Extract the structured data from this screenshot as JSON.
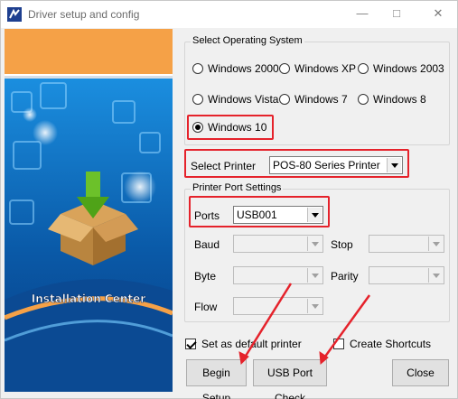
{
  "window": {
    "title": "Driver setup and config",
    "controls": [
      "minimize",
      "maximize",
      "close"
    ]
  },
  "banner": {
    "caption": "Installation Center"
  },
  "os_group": {
    "title": "Select Operating System",
    "options": [
      {
        "label": "Windows 2000",
        "selected": false
      },
      {
        "label": "Windows XP",
        "selected": false
      },
      {
        "label": "Windows 2003",
        "selected": false
      },
      {
        "label": "Windows Vista",
        "selected": false
      },
      {
        "label": "Windows 7",
        "selected": false
      },
      {
        "label": "Windows 8",
        "selected": false
      },
      {
        "label": "Windows 10",
        "selected": true
      }
    ]
  },
  "printer": {
    "label": "Select Printer",
    "value": "POS-80 Series Printer"
  },
  "port_group": {
    "title": "Printer Port Settings",
    "ports_label": "Ports",
    "ports_value": "USB001",
    "baud_label": "Baud",
    "stop_label": "Stop",
    "byte_label": "Byte",
    "parity_label": "Parity",
    "flow_label": "Flow"
  },
  "options": {
    "default_printer": {
      "label": "Set as default printer",
      "checked": true
    },
    "create_shortcuts": {
      "label": "Create Shortcuts",
      "checked": false
    }
  },
  "buttons": {
    "begin_setup": "Begin Setup",
    "usb_check": "USB Port Check",
    "close": "Close"
  },
  "colors": {
    "highlight": "#e5222b",
    "banner_blue": "#0a5aa8",
    "banner_orange": "#f5a147"
  }
}
